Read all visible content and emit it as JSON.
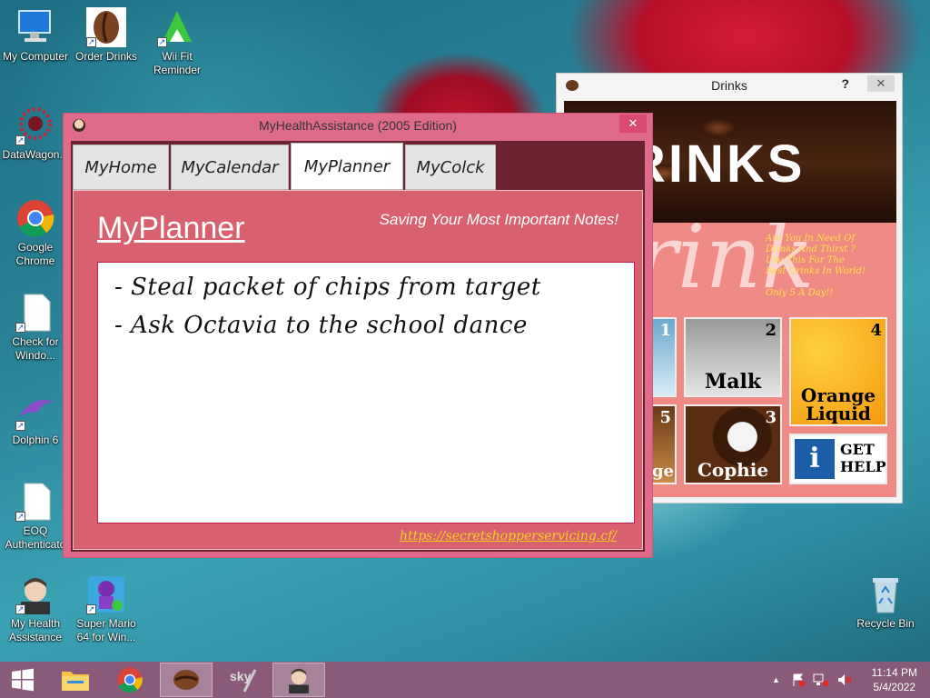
{
  "desktop": {
    "icons": [
      {
        "label": "My Computer",
        "icon": "computer-icon"
      },
      {
        "label": "Order Drinks",
        "icon": "coffee-bean-icon"
      },
      {
        "label": "Wii Fit Reminder",
        "icon": "triforce-icon"
      },
      {
        "label": "DataWagon...",
        "icon": "datawagon-icon"
      },
      {
        "label": "Google Chrome",
        "icon": "chrome-icon"
      },
      {
        "label": "Check for Windo...",
        "icon": "document-icon"
      },
      {
        "label": "Dolphin 6",
        "icon": "dolphin-icon"
      },
      {
        "label": "EOQ Authenticato",
        "icon": "document-icon"
      },
      {
        "label": "My Health Assistance",
        "icon": "avatar-icon"
      },
      {
        "label": "Super Mario 64 for Win...",
        "icon": "mario-icon"
      },
      {
        "label": "Recycle Bin",
        "icon": "recycle-bin-icon"
      }
    ]
  },
  "health_window": {
    "title": "MyHealthAssistance (2005 Edition)",
    "close": "✕",
    "tabs": [
      {
        "label": "MyHome"
      },
      {
        "label": "MyCalendar"
      },
      {
        "label": "MyPlanner"
      },
      {
        "label": "MyColck"
      }
    ],
    "active_tab": "MyPlanner",
    "planner": {
      "heading": "MyPlanner",
      "subtitle": "Saving Your Most Important Notes!",
      "notes": [
        "- Steal packet of chips from target",
        "- Ask Octavia to the school dance"
      ],
      "link": "https://secretshopperservicing.cf/"
    }
  },
  "drinks_window": {
    "title": "Drinks",
    "help": "?",
    "close": "✕",
    "banner_text": "RINKS",
    "big_text": "Drink",
    "promo_lines": [
      "Are You In Need Of",
      "Drinks And Thirst ?",
      "Use This For The",
      "Best Drinks In World!",
      "",
      "Only 5 A Day!!"
    ],
    "tiles": [
      {
        "num": "1",
        "label": ""
      },
      {
        "num": "2",
        "label": "Malk"
      },
      {
        "num": "4",
        "label": "Orange Liquid"
      },
      {
        "num": "5",
        "label": "ge"
      },
      {
        "num": "3",
        "label": "Cophie"
      },
      {
        "num": "",
        "label": "GET HELP"
      }
    ],
    "get_help_label": "GET HELP",
    "info_glyph": "i"
  },
  "taskbar": {
    "clock_time": "11:14 PM",
    "clock_date": "5/4/2022",
    "tray_up": "▲"
  }
}
